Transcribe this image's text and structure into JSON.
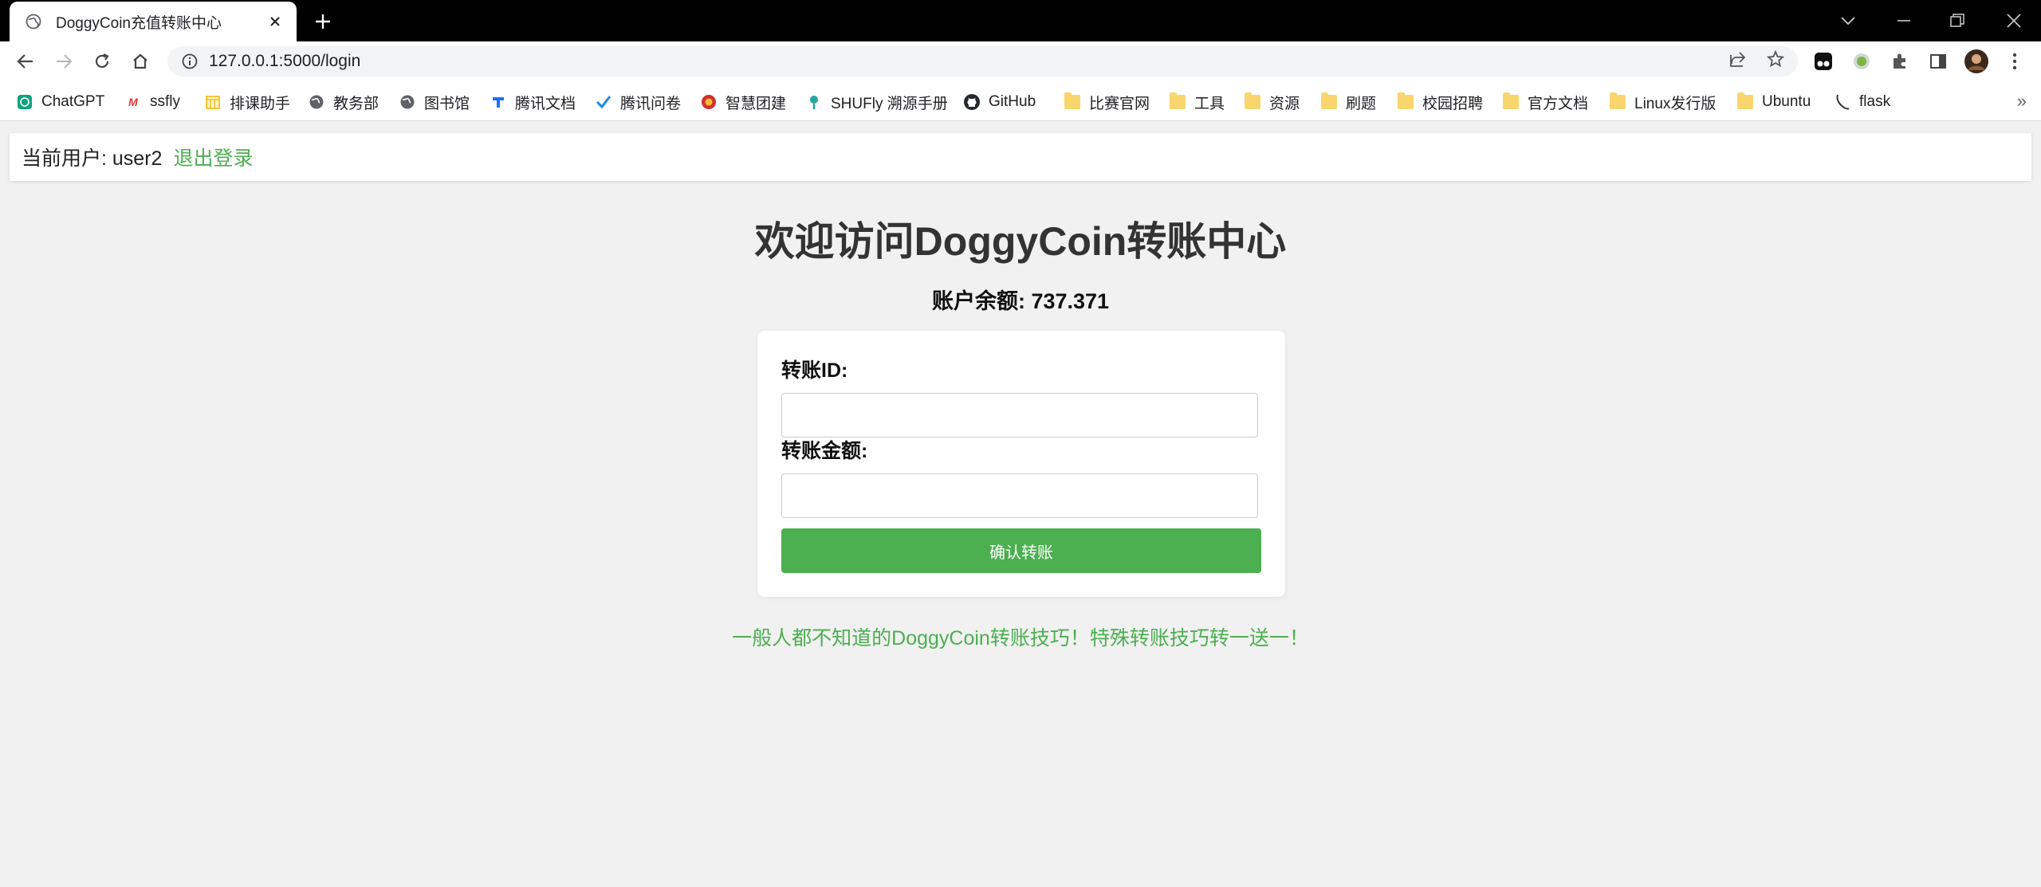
{
  "browser": {
    "tab_title": "DoggyCoin充值转账中心",
    "url": "127.0.0.1:5000/login",
    "bookmarks": [
      {
        "label": "ChatGPT",
        "icon": "chatgpt-icon",
        "color": "#10a37f"
      },
      {
        "label": "ssfly",
        "icon": "ssfly-icon",
        "color": "#e53935"
      },
      {
        "label": "排课助手",
        "icon": "calendar-icon",
        "color": "#f4b400"
      },
      {
        "label": "教务部",
        "icon": "globe-icon",
        "color": "#5f6368"
      },
      {
        "label": "图书馆",
        "icon": "globe-icon",
        "color": "#5f6368"
      },
      {
        "label": "腾讯文档",
        "icon": "tencent-docs-icon",
        "color": "#1e6fff"
      },
      {
        "label": "腾讯问卷",
        "icon": "check-icon",
        "color": "#1e88e5"
      },
      {
        "label": "智慧团建",
        "icon": "badge-icon",
        "color": "#d32f2f"
      },
      {
        "label": "SHUFly 溯源手册",
        "icon": "shufly-icon",
        "color": "#26a69a"
      },
      {
        "label": "GitHub",
        "icon": "github-icon",
        "color": "#24292e"
      },
      {
        "label": "比赛官网",
        "icon": "folder-icon",
        "color": "#f9d66d"
      },
      {
        "label": "工具",
        "icon": "folder-icon",
        "color": "#f9d66d"
      },
      {
        "label": "资源",
        "icon": "folder-icon",
        "color": "#f9d66d"
      },
      {
        "label": "刷题",
        "icon": "folder-icon",
        "color": "#f9d66d"
      },
      {
        "label": "校园招聘",
        "icon": "folder-icon",
        "color": "#f9d66d"
      },
      {
        "label": "官方文档",
        "icon": "folder-icon",
        "color": "#f9d66d"
      },
      {
        "label": "Linux发行版",
        "icon": "folder-icon",
        "color": "#f9d66d"
      },
      {
        "label": "Ubuntu",
        "icon": "folder-icon",
        "color": "#f9d66d"
      },
      {
        "label": "flask",
        "icon": "flask-icon",
        "color": "#333333"
      }
    ],
    "more_bookmarks": "»"
  },
  "page": {
    "user_label": "当前用户: user2",
    "logout_label": "退出登录",
    "title": "欢迎访问DoggyCoin转账中心",
    "balance": "账户余额: 737.371",
    "form": {
      "id_label": "转账ID:",
      "id_value": "",
      "amount_label": "转账金额:",
      "amount_value": "",
      "submit_label": "确认转账"
    },
    "tips_link": "一般人都不知道的DoggyCoin转账技巧！特殊转账技巧转一送一！"
  },
  "colors": {
    "accent": "#4caf50",
    "page_bg": "#f1f1f1"
  }
}
